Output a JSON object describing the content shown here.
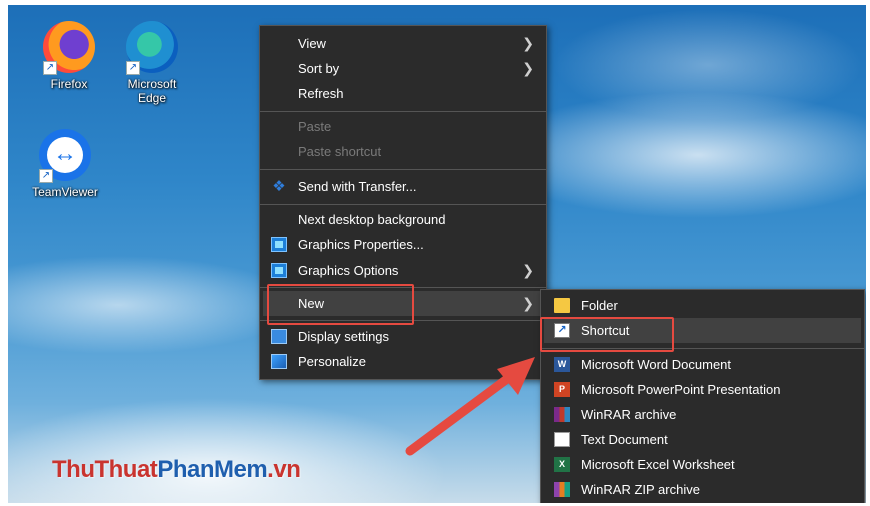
{
  "desktop": {
    "icons": [
      {
        "label": "Firefox",
        "icon": "firefox-icon"
      },
      {
        "label": "Microsoft Edge",
        "icon": "edge-icon"
      },
      {
        "label": "TeamViewer",
        "icon": "teamviewer-icon"
      }
    ]
  },
  "context_menu": {
    "items": [
      {
        "label": "View",
        "submenu": true
      },
      {
        "label": "Sort by",
        "submenu": true
      },
      {
        "label": "Refresh"
      },
      {
        "label": "Paste",
        "disabled": true
      },
      {
        "label": "Paste shortcut",
        "disabled": true
      },
      {
        "label": "Send with Transfer...",
        "icon": "dropbox-icon"
      },
      {
        "label": "Next desktop background"
      },
      {
        "label": "Graphics Properties...",
        "icon": "graphics-icon"
      },
      {
        "label": "Graphics Options",
        "icon": "graphics-icon",
        "submenu": true
      },
      {
        "label": "New",
        "submenu": true,
        "highlighted": true
      },
      {
        "label": "Display settings",
        "icon": "display-icon"
      },
      {
        "label": "Personalize",
        "icon": "personalize-icon"
      }
    ]
  },
  "new_submenu": {
    "items": [
      {
        "label": "Folder",
        "icon": "folder-icon"
      },
      {
        "label": "Shortcut",
        "icon": "shortcut-icon",
        "highlighted": true
      },
      {
        "label": "Microsoft Word Document",
        "icon": "word-icon"
      },
      {
        "label": "Microsoft PowerPoint Presentation",
        "icon": "powerpoint-icon"
      },
      {
        "label": "WinRAR archive",
        "icon": "winrar-icon"
      },
      {
        "label": "Text Document",
        "icon": "text-document-icon"
      },
      {
        "label": "Microsoft Excel Worksheet",
        "icon": "excel-icon"
      },
      {
        "label": "WinRAR ZIP archive",
        "icon": "winrar-zip-icon"
      }
    ]
  },
  "watermark": {
    "part1": "ThuThuat",
    "part2": "PhanMem",
    "part3": ".vn"
  },
  "colors": {
    "highlight_box": "#e54a40",
    "menu_bg": "#2b2b2b",
    "arrow": "#e54a40"
  }
}
